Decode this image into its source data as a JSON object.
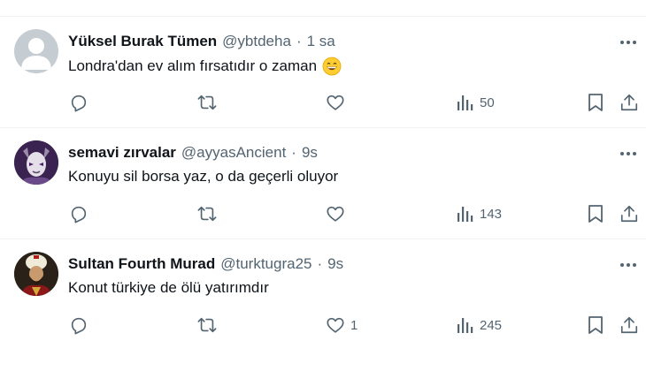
{
  "tweets": [
    {
      "name": "Yüksel Burak Tümen",
      "handle": "@ybtdeha",
      "separator": "·",
      "time": "1 sa",
      "text": "Londra'dan ev alım fırsatıdır o zaman",
      "emoji": "grinning-face-emoji",
      "avatar": "default-avatar",
      "likes": "",
      "views": "50"
    },
    {
      "name": "semavi zırvalar",
      "handle": "@ayyasAncient",
      "separator": "·",
      "time": "9s",
      "text": "Konuyu sil borsa yaz, o da geçerli oluyor",
      "avatar": "masked-character-avatar",
      "likes": "",
      "views": "143"
    },
    {
      "name": "Sultan Fourth Murad",
      "handle": "@turktugra25",
      "separator": "·",
      "time": "9s",
      "text": "Konut türkiye de ölü yatırımdır",
      "avatar": "sultan-portrait-avatar",
      "likes": "1",
      "views": "245"
    }
  ],
  "icons": {
    "reply": "reply-icon",
    "retweet": "retweet-icon",
    "like": "like-icon",
    "views": "views-icon",
    "bookmark": "bookmark-icon",
    "share": "share-icon",
    "more": "more-icon"
  },
  "colors": {
    "text": "#0f1419",
    "secondary": "#536471",
    "divider": "#eff3f4"
  }
}
